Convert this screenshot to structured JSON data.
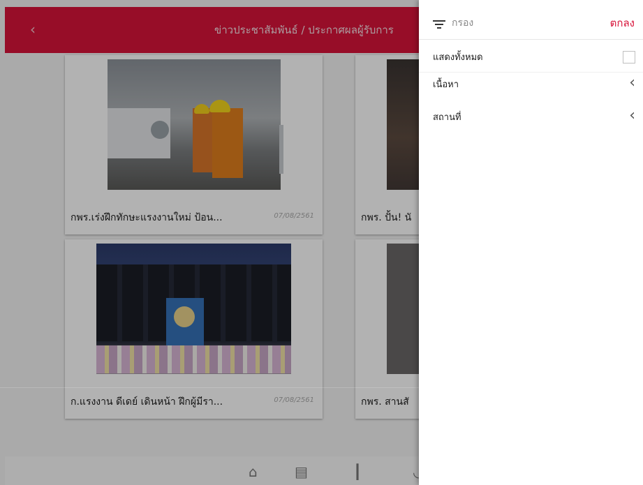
{
  "header": {
    "back_icon": "chevron-left-icon",
    "back_glyph": "‹",
    "title": "ข่าวประชาสัมพันธ์ / ประกาศผลผู้รับการ"
  },
  "cards": [
    {
      "caption": "กพร.เร่งฝึกทักษะแรงงานใหม่ ป้อน...",
      "date": "07/08/2561"
    },
    {
      "caption": "กพร. ปั้น! นั"
    },
    {
      "caption": "ก.แรงงาน ดีเดย์ เดินหน้า ฝึกผู้มีรา...",
      "date": "07/08/2561"
    },
    {
      "caption": "กพร. สานสั"
    }
  ],
  "bottom_nav": [
    {
      "icon": "home-icon",
      "glyph": "⌂"
    },
    {
      "icon": "document-icon",
      "glyph": "▤"
    },
    {
      "icon": "bar-chart-icon",
      "glyph": "┃"
    },
    {
      "icon": "chat-icon",
      "glyph": "◟"
    }
  ],
  "filter_panel": {
    "title": "กรอง",
    "confirm": "ตกลง",
    "show_all": "แสดงทั้งหมด",
    "items": [
      {
        "label": "เนื้อหา"
      },
      {
        "label": "สถานที่"
      }
    ],
    "chevron_glyph": "‹"
  },
  "colors": {
    "brand_red": "#d8143a"
  }
}
